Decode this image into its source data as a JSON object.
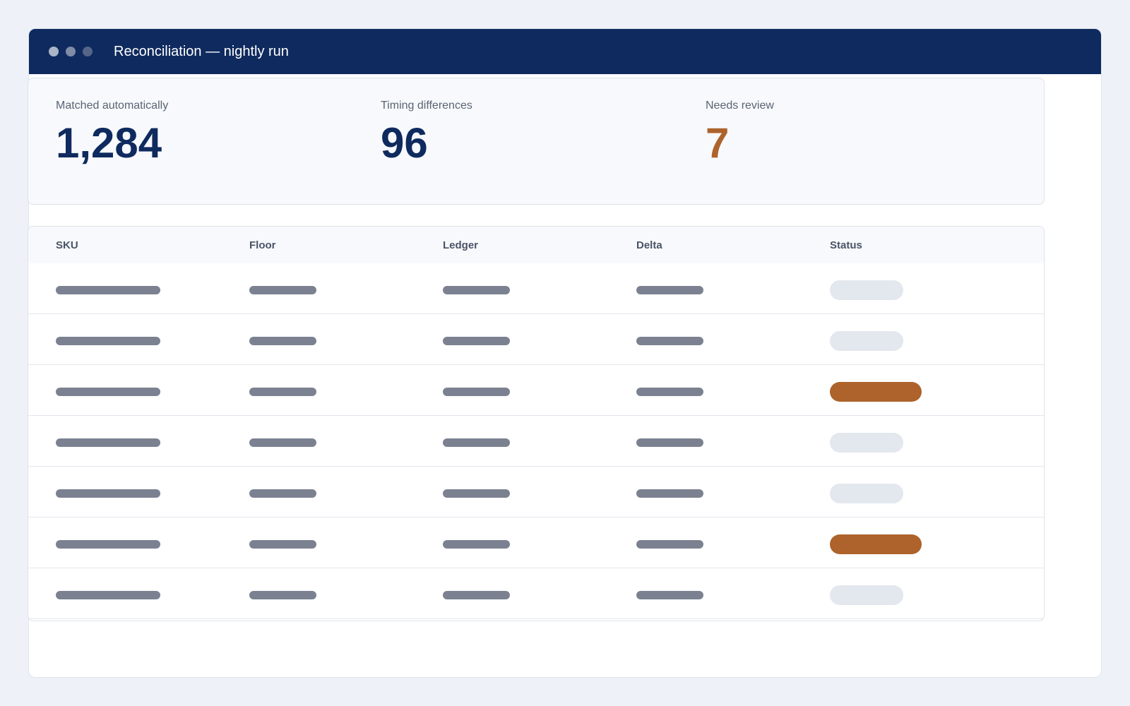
{
  "window": {
    "title": "Reconciliation — nightly run"
  },
  "stats": [
    {
      "label": "Matched automatically",
      "value": "1,284",
      "color": "#0f2a5e"
    },
    {
      "label": "Timing differences",
      "value": "96",
      "color": "#0f2a5e"
    },
    {
      "label": "Needs review",
      "value": "7",
      "color": "#ad632b"
    }
  ],
  "table": {
    "columns": [
      "SKU",
      "Floor",
      "Ledger",
      "Delta",
      "Status"
    ],
    "row_statuses": [
      "neutral",
      "neutral",
      "alert",
      "neutral",
      "neutral",
      "alert",
      "neutral"
    ]
  },
  "colors": {
    "titlebar": "#0f2a5e",
    "accent_alert": "#ad632b",
    "placeholder": "#7b8190"
  }
}
